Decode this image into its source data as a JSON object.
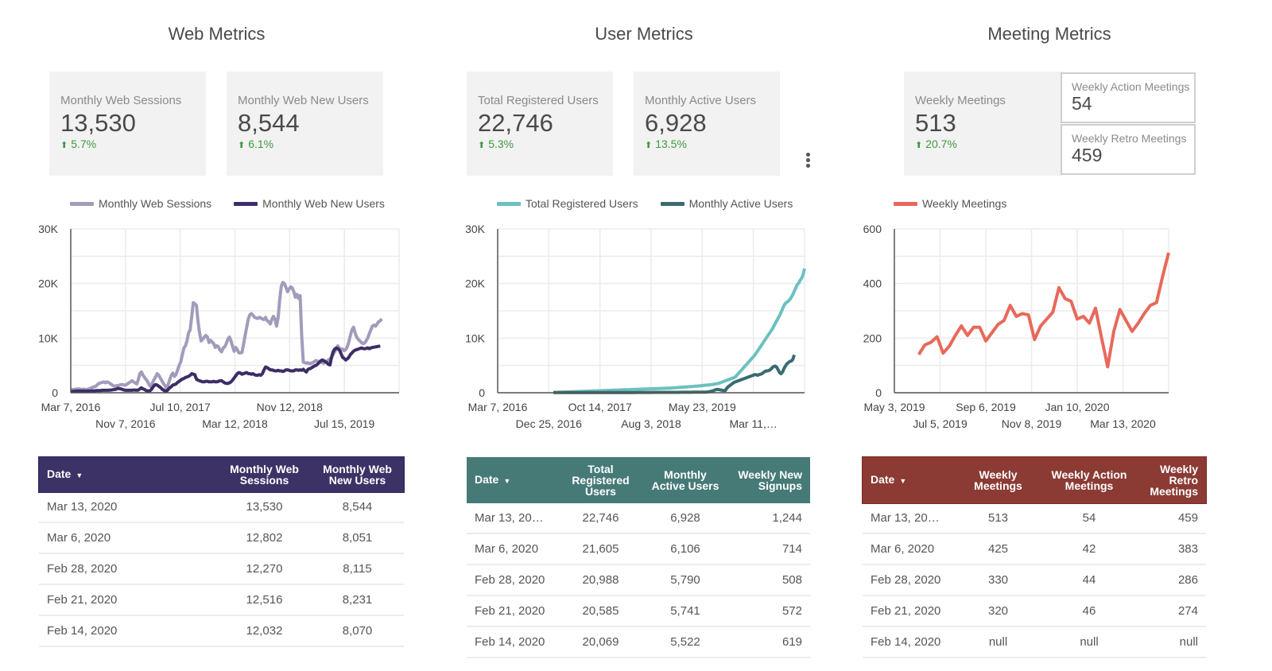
{
  "sections": {
    "web": {
      "title": "Web Metrics",
      "color": "#3d3266",
      "scorecards": [
        {
          "label": "Monthly Web Sessions",
          "value": "13,530",
          "delta": "5.7%",
          "trend": "up"
        },
        {
          "label": "Monthly Web New Users",
          "value": "8,544",
          "delta": "6.1%",
          "trend": "up"
        }
      ],
      "table": {
        "columns": [
          "Date",
          "Monthly Web Sessions",
          "Monthly Web New Users"
        ],
        "sort_column": "Date",
        "rows": [
          [
            "Mar 13, 2020",
            "13,530",
            "8,544"
          ],
          [
            "Mar 6, 2020",
            "12,802",
            "8,051"
          ],
          [
            "Feb 28, 2020",
            "12,270",
            "8,115"
          ],
          [
            "Feb 21, 2020",
            "12,516",
            "8,231"
          ],
          [
            "Feb 14, 2020",
            "12,032",
            "8,070"
          ]
        ]
      }
    },
    "user": {
      "title": "User Metrics",
      "color": "#467a77",
      "scorecards": [
        {
          "label": "Total Registered Users",
          "value": "22,746",
          "delta": "5.3%",
          "trend": "up"
        },
        {
          "label": "Monthly Active Users",
          "value": "6,928",
          "delta": "13.5%",
          "trend": "up"
        }
      ],
      "menu_icon": "more-vert-icon",
      "table": {
        "columns": [
          "Date",
          "Total Registered Users",
          "Monthly Active Users",
          "Weekly New Signups"
        ],
        "sort_column": "Date",
        "rows": [
          [
            "Mar 13, 20…",
            "22,746",
            "6,928",
            "1,244"
          ],
          [
            "Mar 6, 2020",
            "21,605",
            "6,106",
            "714"
          ],
          [
            "Feb 28, 2020",
            "20,988",
            "5,790",
            "508"
          ],
          [
            "Feb 21, 2020",
            "20,585",
            "5,741",
            "572"
          ],
          [
            "Feb 14, 2020",
            "20,069",
            "5,522",
            "619"
          ]
        ]
      }
    },
    "meeting": {
      "title": "Meeting Metrics",
      "color": "#8b3b34",
      "scorecards": [
        {
          "label": "Weekly Meetings",
          "value": "513",
          "delta": "20.7%",
          "trend": "up"
        }
      ],
      "mini_cards": [
        {
          "label": "Weekly Action Meetings",
          "value": "54"
        },
        {
          "label": "Weekly Retro Meetings",
          "value": "459"
        }
      ],
      "table": {
        "columns": [
          "Date",
          "Weekly Meetings",
          "Weekly Action Meetings",
          "Weekly Retro Meetings"
        ],
        "sort_column": "Date",
        "rows": [
          [
            "Mar 13, 20…",
            "513",
            "54",
            "459"
          ],
          [
            "Mar 6, 2020",
            "425",
            "42",
            "383"
          ],
          [
            "Feb 28, 2020",
            "330",
            "44",
            "286"
          ],
          [
            "Feb 21, 2020",
            "320",
            "46",
            "274"
          ],
          [
            "Feb 14, 2020",
            "null",
            "null",
            "null"
          ]
        ]
      }
    }
  },
  "chart_data": [
    {
      "type": "line",
      "title": "",
      "xlabel": "",
      "ylabel": "",
      "ylim": [
        0,
        30000
      ],
      "yticks": [
        "0",
        "10K",
        "20K",
        "30K"
      ],
      "xticks_top": [
        "Mar 7, 2016",
        "Jul 10, 2017",
        "Nov 12, 2018"
      ],
      "xticks_bottom": [
        "Nov 7, 2016",
        "Mar 12, 2018",
        "Jul 15, 2019"
      ],
      "grid": true,
      "legend": "top",
      "x_count": 210,
      "series": [
        {
          "name": "Monthly Web Sessions",
          "color": "#a39bbb",
          "values": [
            500,
            600,
            550,
            650,
            700,
            700,
            650,
            600,
            650,
            600,
            600,
            650,
            700,
            900,
            1000,
            1100,
            1200,
            1500,
            1700,
            1800,
            1900,
            2000,
            1800,
            2000,
            1900,
            1700,
            1500,
            1300,
            1200,
            1300,
            1300,
            1400,
            1500,
            1500,
            1400,
            1400,
            1600,
            1800,
            2000,
            2200,
            2000,
            1800,
            1600,
            2400,
            3500,
            3800,
            3200,
            2800,
            2400,
            2000,
            1400,
            1100,
            1800,
            2400,
            2900,
            3500,
            3200,
            2700,
            2200,
            1700,
            1300,
            800,
            1500,
            2400,
            3200,
            3600,
            3000,
            3300,
            4200,
            5000,
            5600,
            6900,
            8200,
            8600,
            9500,
            11000,
            11500,
            14000,
            16500,
            16300,
            16000,
            13000,
            11000,
            9500,
            9800,
            10200,
            10500,
            10200,
            9200,
            9600,
            9300,
            9000,
            8300,
            8600,
            8400,
            7800,
            7500,
            8200,
            8400,
            9000,
            9800,
            10200,
            9500,
            8500,
            7600,
            8300,
            7900,
            7300,
            7300,
            7400,
            8900,
            10500,
            12000,
            13500,
            14300,
            14500,
            14200,
            13800,
            13700,
            13600,
            13800,
            13700,
            13500,
            13400,
            13800,
            13200,
            13000,
            12600,
            13400,
            14000,
            13500,
            12200,
            13700,
            17000,
            19500,
            20200,
            20000,
            19300,
            18500,
            19000,
            19400,
            19200,
            18500,
            17500,
            18000,
            17300,
            17800,
            10500,
            5600,
            5500,
            5400,
            5500,
            5300,
            5400,
            5500,
            5700,
            5900,
            5800,
            5700,
            5600,
            5500,
            5400,
            5600,
            5800,
            6000,
            6200,
            6400,
            7000,
            7500,
            8000,
            8600,
            8200,
            7800,
            8000,
            7700,
            7900,
            8400,
            9300,
            10500,
            11500,
            12000,
            11000,
            10200,
            9800,
            9500,
            9200,
            9000,
            9100,
            9500,
            10000,
            10800,
            11500,
            12200,
            12400,
            12200,
            12600,
            13000,
            13200,
            13530
          ]
        },
        {
          "name": "Monthly Web New Users",
          "color": "#3d2d66",
          "values": [
            200,
            250,
            250,
            300,
            300,
            300,
            300,
            300,
            300,
            300,
            300,
            300,
            300,
            300,
            350,
            350,
            400,
            400,
            400,
            400,
            450,
            450,
            450,
            450,
            450,
            500,
            500,
            550,
            600,
            650,
            800,
            750,
            700,
            600,
            500,
            450,
            450,
            450,
            450,
            450,
            500,
            500,
            450,
            500,
            700,
            900,
            700,
            600,
            400,
            350,
            300,
            500,
            900,
            1300,
            1500,
            1400,
            1200,
            1000,
            700,
            500,
            300,
            300,
            600,
            900,
            1100,
            1400,
            1500,
            1600,
            1900,
            2100,
            2300,
            2500,
            2600,
            2800,
            2900,
            3000,
            3200,
            3500,
            3400,
            3300,
            2500,
            2300,
            2200,
            2100,
            2000,
            2000,
            2100,
            2100,
            2000,
            2000,
            2000,
            2100,
            2000,
            2000,
            2100,
            2200,
            2200,
            2000,
            1800,
            1700,
            1700,
            1800,
            2000,
            2300,
            2700,
            3100,
            3500,
            3700,
            3600,
            3400,
            3500,
            3600,
            3700,
            3500,
            3500,
            3400,
            3500,
            3300,
            3200,
            3200,
            3300,
            3200,
            3500,
            4200,
            4700,
            4600,
            4400,
            4200,
            4200,
            4100,
            4000,
            4000,
            4100,
            4000,
            4000,
            3900,
            4000,
            4200,
            4200,
            4100,
            4000,
            4000,
            4000,
            4200,
            4200,
            4100,
            4200,
            4100,
            4300,
            4000,
            3800,
            4300,
            4400,
            4500,
            4700,
            4900,
            5000,
            5200,
            5500,
            5800,
            6000,
            5900,
            5700,
            5500,
            5200,
            5100,
            6500,
            7500,
            8000,
            8200,
            8100,
            7800,
            7200,
            6500,
            6300,
            6000,
            6200,
            6500,
            7000,
            7300,
            7600,
            7800,
            7900,
            8000,
            8100,
            8200,
            8100,
            8051,
            8115,
            8231,
            8070,
            8200,
            8300,
            8350,
            8400,
            8450,
            8500,
            8544
          ]
        }
      ]
    },
    {
      "type": "line",
      "title": "",
      "xlabel": "",
      "ylabel": "",
      "ylim": [
        0,
        30000
      ],
      "yticks": [
        "0",
        "10K",
        "20K",
        "30K"
      ],
      "xticks_top": [
        "Mar 7, 2016",
        "Oct 14, 2017",
        "May 23, 2019"
      ],
      "xticks_bottom": [
        "Dec 25, 2016",
        "Aug 3, 2018",
        "Mar 11,…"
      ],
      "grid": true,
      "legend": "top",
      "x_count": 210,
      "x_start_index": 38,
      "series": [
        {
          "name": "Total Registered Users",
          "color": "#6cc0c0",
          "values": [
            50,
            60,
            70,
            80,
            90,
            100,
            110,
            120,
            130,
            140,
            150,
            160,
            170,
            180,
            190,
            200,
            210,
            220,
            230,
            240,
            250,
            260,
            270,
            280,
            290,
            300,
            310,
            320,
            330,
            340,
            350,
            360,
            370,
            380,
            390,
            400,
            410,
            420,
            430,
            440,
            450,
            460,
            470,
            480,
            490,
            500,
            510,
            520,
            530,
            540,
            550,
            560,
            570,
            580,
            590,
            600,
            610,
            620,
            630,
            640,
            650,
            660,
            670,
            680,
            690,
            700,
            710,
            720,
            730,
            740,
            750,
            760,
            770,
            780,
            790,
            800,
            810,
            820,
            830,
            840,
            850,
            870,
            890,
            910,
            930,
            950,
            970,
            990,
            1010,
            1030,
            1050,
            1070,
            1090,
            1110,
            1130,
            1150,
            1170,
            1190,
            1210,
            1230,
            1250,
            1280,
            1310,
            1340,
            1370,
            1400,
            1430,
            1460,
            1490,
            1520,
            1560,
            1600,
            1650,
            1700,
            1800,
            1900,
            2000,
            2100,
            2200,
            2300,
            2400,
            2500,
            2600,
            2700,
            2800,
            3000,
            3300,
            3600,
            3900,
            4200,
            4500,
            4800,
            5100,
            5400,
            5700,
            6000,
            6300,
            6600,
            6900,
            7300,
            7700,
            8100,
            8500,
            8900,
            9300,
            9700,
            10100,
            10500,
            10900,
            11300,
            11700,
            12200,
            12700,
            13200,
            13700,
            14200,
            14800,
            15400,
            16000,
            16400,
            16600,
            16800,
            17100,
            17500,
            18000,
            18600,
            19200,
            19800,
            20069,
            20585,
            20988,
            21605,
            22746
          ]
        },
        {
          "name": "Monthly Active Users",
          "color": "#3a6b6e",
          "values": [
            50,
            50,
            50,
            50,
            50,
            50,
            50,
            50,
            50,
            50,
            50,
            50,
            50,
            50,
            50,
            50,
            50,
            50,
            50,
            50,
            50,
            50,
            50,
            50,
            50,
            50,
            50,
            50,
            50,
            50,
            50,
            50,
            50,
            50,
            50,
            50,
            50,
            50,
            50,
            50,
            50,
            50,
            50,
            50,
            50,
            50,
            50,
            50,
            50,
            50,
            50,
            50,
            50,
            50,
            50,
            50,
            50,
            60,
            60,
            60,
            60,
            60,
            60,
            60,
            60,
            60,
            60,
            60,
            70,
            70,
            70,
            70,
            70,
            70,
            70,
            70,
            70,
            80,
            80,
            80,
            80,
            80,
            80,
            80,
            80,
            80,
            90,
            90,
            90,
            90,
            90,
            90,
            90,
            90,
            90,
            100,
            100,
            100,
            100,
            100,
            100,
            100,
            100,
            100,
            120,
            150,
            200,
            250,
            300,
            400,
            500,
            600,
            600,
            550,
            500,
            450,
            400,
            400,
            800,
            1100,
            1300,
            1500,
            1700,
            1900,
            2000,
            2100,
            2200,
            2300,
            2400,
            2500,
            2600,
            2700,
            2800,
            2900,
            3000,
            3100,
            3200,
            3300,
            3300,
            3200,
            3300,
            3400,
            3500,
            3700,
            3900,
            4000,
            4000,
            4100,
            4300,
            4600,
            4800,
            4900,
            4700,
            4200,
            3700,
            3500,
            3800,
            4400,
            4900,
            5300,
            5522,
            5741,
            5790,
            6106,
            6928
          ]
        }
      ]
    },
    {
      "type": "line",
      "title": "",
      "xlabel": "",
      "ylabel": "",
      "ylim": [
        0,
        600
      ],
      "yticks": [
        "0",
        "200",
        "400",
        "600"
      ],
      "xticks_top": [
        "May 3, 2019",
        "Sep 6, 2019",
        "Jan 10, 2020"
      ],
      "xticks_bottom": [
        "Jul 5, 2019",
        "Nov 8, 2019",
        "Mar 13, 2020"
      ],
      "grid": true,
      "legend": "top",
      "x_count": 46,
      "x_start_index": 4,
      "series": [
        {
          "name": "Weekly Meetings",
          "color": "#e8695a",
          "values": [
            140,
            175,
            185,
            205,
            145,
            170,
            210,
            245,
            210,
            240,
            240,
            190,
            220,
            250,
            265,
            320,
            280,
            290,
            285,
            195,
            245,
            270,
            295,
            385,
            345,
            335,
            270,
            280,
            255,
            310,
            200,
            95,
            225,
            305,
            265,
            225,
            255,
            290,
            320,
            330,
            425,
            513
          ]
        }
      ]
    }
  ]
}
